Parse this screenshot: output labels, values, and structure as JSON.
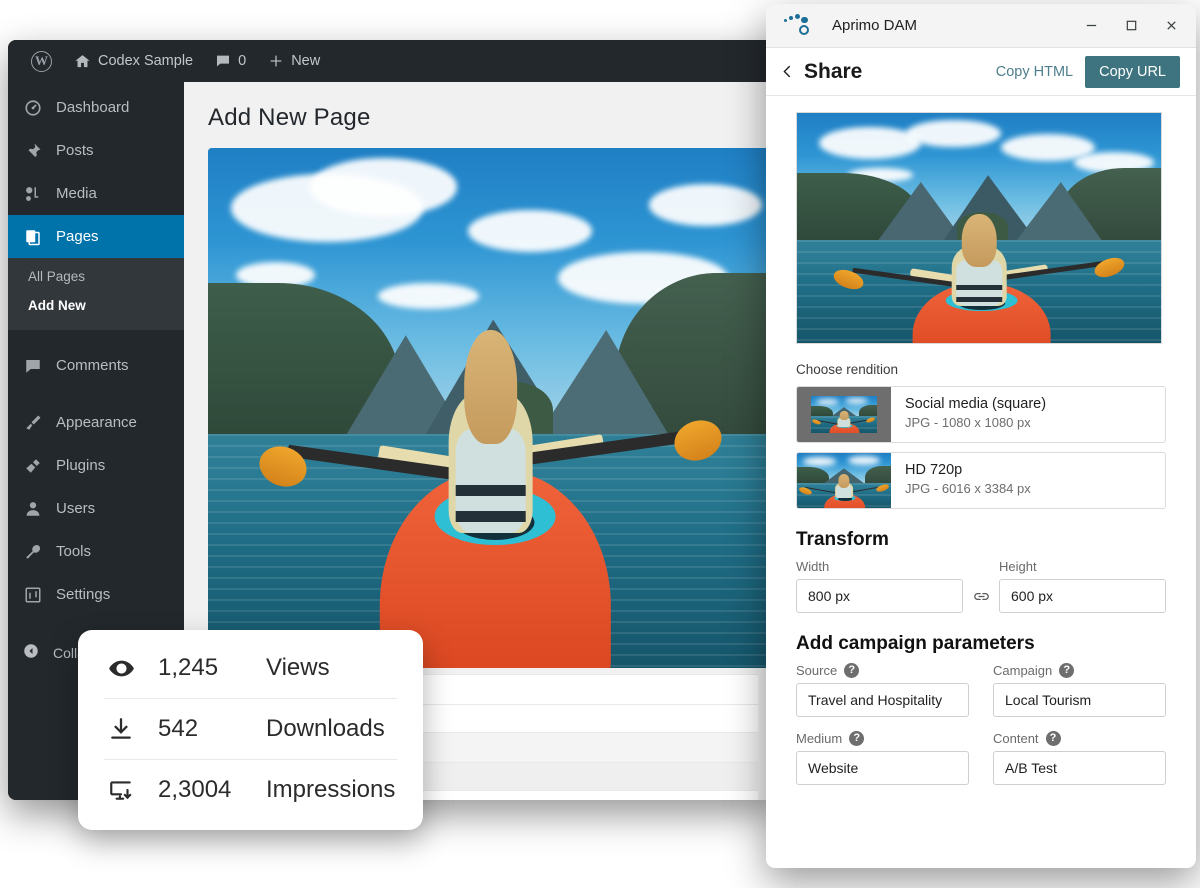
{
  "wordpress": {
    "adminbar": {
      "logo_icon": "wordpress-logo-icon",
      "site_icon": "home-icon",
      "site_name": "Codex Sample",
      "comments_icon": "comment-bubble-icon",
      "comments_count": "0",
      "new_icon": "plus-icon",
      "new_label": "New"
    },
    "sidebar": {
      "items": [
        {
          "label": "Dashboard",
          "icon": "dashboard-icon",
          "active": false
        },
        {
          "label": "Posts",
          "icon": "pin-icon",
          "active": false
        },
        {
          "label": "Media",
          "icon": "media-icon",
          "active": false
        },
        {
          "label": "Pages",
          "icon": "pages-icon",
          "active": true
        },
        {
          "label": "Comments",
          "icon": "comment-icon",
          "active": false
        },
        {
          "label": "Appearance",
          "icon": "paintbrush-icon",
          "active": false
        },
        {
          "label": "Plugins",
          "icon": "plug-icon",
          "active": false
        },
        {
          "label": "Users",
          "icon": "user-icon",
          "active": false
        },
        {
          "label": "Tools",
          "icon": "wrench-icon",
          "active": false
        },
        {
          "label": "Settings",
          "icon": "settings-icon",
          "active": false
        }
      ],
      "submenu": [
        {
          "label": "All Pages",
          "current": false
        },
        {
          "label": "Add New",
          "current": true
        }
      ],
      "collapse_label": "Collapse menu",
      "collapse_icon": "collapse-arrow-icon"
    },
    "page_title": "Add New Page",
    "hero_image_alt": "Woman kayaking on a blue mountain lake"
  },
  "stats": {
    "rows": [
      {
        "icon": "eye-icon",
        "value": "1,245",
        "label": "Views"
      },
      {
        "icon": "download-icon",
        "value": "542",
        "label": "Downloads"
      },
      {
        "icon": "monitor-download-icon",
        "value": "2,3004",
        "label": "Impressions"
      }
    ]
  },
  "dam": {
    "titlebar": {
      "logo_icon": "aprimo-logo-icon",
      "title": "Aprimo DAM",
      "minimize_icon": "minimize-icon",
      "maximize_icon": "maximize-icon",
      "close_icon": "close-icon"
    },
    "header": {
      "back_icon": "chevron-left-icon",
      "title": "Share",
      "copy_html_label": "Copy HTML",
      "copy_url_label": "Copy URL",
      "accent_color": "#3d7480",
      "link_color": "#4d7f8c"
    },
    "preview_alt": "Kayaker on lake preview",
    "renditions": {
      "label": "Choose rendition",
      "options": [
        {
          "name": "Social media (square)",
          "meta": "JPG - 1080 x 1080 px",
          "crop": "square"
        },
        {
          "name": "HD 720p",
          "meta": "JPG - 6016 x 3384 px",
          "crop": "wide"
        }
      ]
    },
    "transform": {
      "heading": "Transform",
      "width_label": "Width",
      "width_value": "800 px",
      "height_label": "Height",
      "height_value": "600 px",
      "link_icon": "chain-link-icon"
    },
    "campaign": {
      "heading": "Add campaign parameters",
      "help_glyph": "?",
      "fields": [
        {
          "label": "Source",
          "value": "Travel and Hospitality",
          "help_icon": "help-circle-icon"
        },
        {
          "label": "Campaign",
          "value": "Local Tourism",
          "help_icon": "help-circle-icon"
        },
        {
          "label": "Medium",
          "value": "Website",
          "help_icon": "help-circle-icon"
        },
        {
          "label": "Content",
          "value": "A/B Test",
          "help_icon": "help-circle-icon"
        }
      ]
    }
  }
}
